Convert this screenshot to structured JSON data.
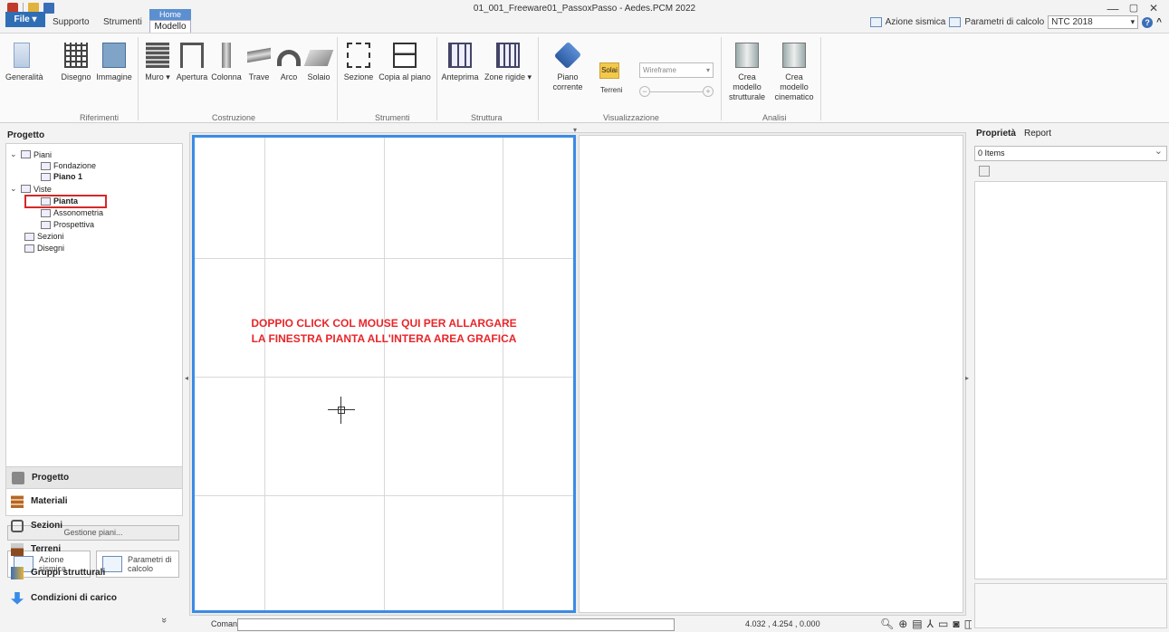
{
  "window": {
    "title": "01_001_Freeware01_PassoxPasso - Aedes.PCM 2022",
    "minimize": "—",
    "maximize": "▢",
    "close": "✕"
  },
  "tabs": {
    "file": "File ▾",
    "supporto": "Supporto",
    "strumenti": "Strumenti",
    "home": "Home",
    "modello": "Modello"
  },
  "topright": {
    "azione_sismica": "Azione sismica",
    "parametri_calcolo": "Parametri di calcolo",
    "norma": "NTC 2018",
    "help": "?",
    "collapse": "^"
  },
  "ribbon": {
    "riferimenti": {
      "label": "Riferimenti",
      "buttons": [
        "Generalità",
        "Disegno",
        "Immagine"
      ]
    },
    "costruzione": {
      "label": "Costruzione",
      "buttons": [
        "Muro ▾",
        "Apertura",
        "Colonna",
        "Trave",
        "Arco",
        "Solaio"
      ]
    },
    "strumenti": {
      "label": "Strumenti",
      "buttons": [
        "Sezione",
        "Copia al piano"
      ]
    },
    "struttura": {
      "label": "Struttura",
      "buttons": [
        "Anteprima",
        "Zone rigide ▾"
      ]
    },
    "visualizzazione": {
      "label": "Visualizzazione",
      "piano_corrente": "Piano corrente",
      "solai": "Solai",
      "terreni": "Terreni",
      "wireframe": "Wireframe",
      "minus": "−",
      "plus": "+"
    },
    "analisi": {
      "label": "Analisi",
      "crea_strutturale": [
        "Crea modello",
        "strutturale"
      ],
      "crea_cinematico": [
        "Crea modello",
        "cinematico"
      ]
    }
  },
  "left": {
    "header": "Progetto",
    "tree": {
      "piani": "Piani",
      "fondazione": "Fondazione",
      "piano1": "Piano 1",
      "viste": "Viste",
      "pianta": "Pianta",
      "assonometria": "Assonometria",
      "prospettiva": "Prospettiva",
      "sezioni": "Sezioni",
      "disegni": "Disegni"
    },
    "gestione_piani": "Gestione piani...",
    "azione_btn": [
      "Azione",
      "sismica"
    ],
    "parametri_btn": [
      "Parametri di",
      "calcolo"
    ],
    "nav": [
      "Progetto",
      "Materiali",
      "Sezioni",
      "Terreni",
      "Gruppi strutturali",
      "Condizioni di carico"
    ],
    "more": "»"
  },
  "canvas": {
    "annotation_line1": "DOPPIO CLICK COL MOUSE QUI PER ALLARGARE",
    "annotation_line2": "LA FINESTRA PIANTA ALL'INTERA AREA GRAFICA"
  },
  "command": {
    "label": "Comando",
    "value": "",
    "coords": "4.032 , 4.254 , 0.000"
  },
  "right": {
    "tab_prop": "Proprietà",
    "tab_report": "Report",
    "items": "0 Items"
  }
}
